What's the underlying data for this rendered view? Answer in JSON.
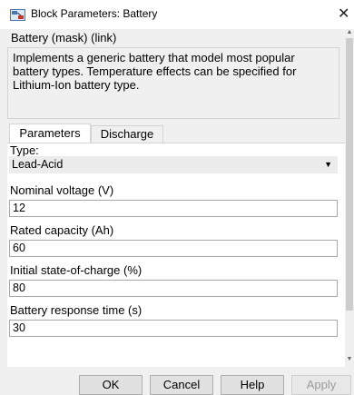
{
  "window": {
    "title": "Block Parameters: Battery",
    "close": "✕"
  },
  "mask_title": "Battery (mask) (link)",
  "description": "Implements a generic battery that model most popular battery types. Temperature effects can be specified for Lithium-Ion battery type.",
  "tabs": [
    {
      "label": "Parameters",
      "active": true
    },
    {
      "label": "Discharge",
      "active": false
    }
  ],
  "params": {
    "type": {
      "label": "Type:",
      "value": "Lead-Acid"
    },
    "nominal_voltage": {
      "label": "Nominal voltage (V)",
      "value": "12"
    },
    "rated_capacity": {
      "label": "Rated capacity (Ah)",
      "value": "60"
    },
    "initial_soc": {
      "label": "Initial state-of-charge (%)",
      "value": "80"
    },
    "response_time": {
      "label": "Battery response time (s)",
      "value": "30"
    }
  },
  "buttons": {
    "ok": "OK",
    "cancel": "Cancel",
    "help": "Help",
    "apply": "Apply"
  },
  "icons": {
    "app": "simulink-block-icon",
    "dropdown": "chevron-down-icon"
  },
  "colors": {
    "panel_bg": "#ffffff",
    "dialog_bg": "#f0f0f0",
    "field_border": "#a8a8a8"
  }
}
